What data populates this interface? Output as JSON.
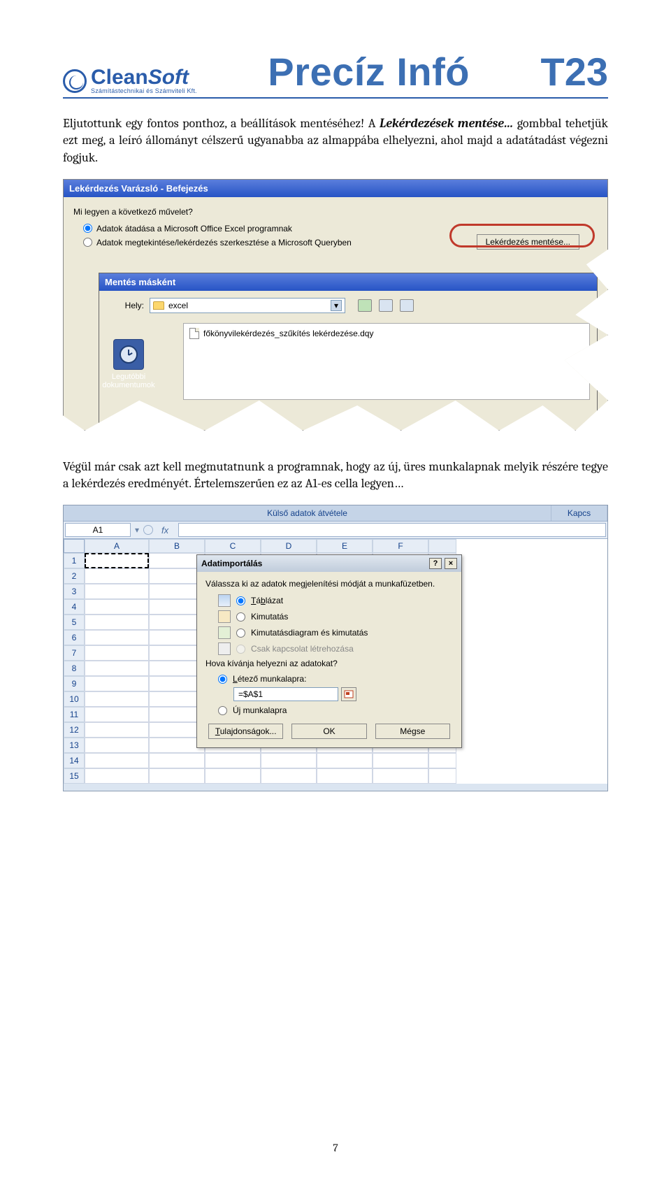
{
  "header": {
    "logo_main": "Clean",
    "logo_soft": "Soft",
    "logo_sub": "Számítástechnikai és Számviteli Kft.",
    "title_center": "Precíz Infó",
    "title_right": "T23"
  },
  "paragraph1_a": "Eljutottunk egy fontos ponthoz, a beállítások mentéséhez! A ",
  "paragraph1_b": "Lekérdezések mentése…",
  "paragraph1_c": " gombbal tehetjük ezt meg, a leíró állományt célszerű ugyanabba az almappába elhelyezni, ahol majd a adatátadást végezni fogjuk.",
  "shot1": {
    "titlebar": "Lekérdezés Varázsló - Befejezés",
    "label_top": "Mi legyen a következő művelet?",
    "radio1": "Adatok átadása a Microsoft Office Excel programnak",
    "radio2": "Adatok megtekintése/lekérdezés szerkesztése a Microsoft Queryben",
    "save_button": "Lekérdezés mentése...",
    "inner_title": "Mentés másként",
    "hely_label": "Hely:",
    "hely_value": "excel",
    "file1": "főkönyvilekérdezés_szűkítés lekérdezése.dqy",
    "side_label": "Legutóbbi dokumentumok"
  },
  "paragraph2": "Végül már csak azt kell megmutatnunk a programnak, hogy az új, üres munkalapnak melyik részére tegye a lekérdezés eredményét. Értelemszerűen ez az A1-es cella legyen…",
  "shot2": {
    "ribbon1": "Külső adatok átvétele",
    "ribbon2": "Kapcs",
    "namebox": "A1",
    "fx": "fx",
    "cols": [
      "A",
      "B",
      "C",
      "D",
      "E",
      "F"
    ],
    "rows": [
      "1",
      "2",
      "3",
      "4",
      "5",
      "6",
      "7",
      "8",
      "9",
      "10",
      "11",
      "12",
      "13",
      "14",
      "15"
    ],
    "dlg_title": "Adatimportálás",
    "dlg_q1": "Válassza ki az adatok megjelenítési módját a munkafüzetben.",
    "opt_table": "Táblázat",
    "opt_pivot": "Kimutatás",
    "opt_pivotchart": "Kimutatásdiagram és kimutatás",
    "opt_conn": "Csak kapcsolat létrehozása",
    "dlg_q2": "Hova kívánja helyezni az adatokat?",
    "opt_existing": "Létező munkalapra:",
    "ref_value": "=$A$1",
    "opt_new": "Új munkalapra",
    "btn_props": "Tulajdonságok...",
    "btn_ok": "OK",
    "btn_cancel": "Mégse",
    "help_mark": "?",
    "close_mark": "×"
  },
  "page_number": "7"
}
